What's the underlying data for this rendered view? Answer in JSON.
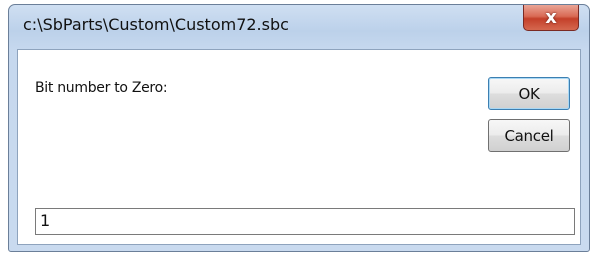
{
  "window": {
    "title": "c:\\SbParts\\Custom\\Custom72.sbc",
    "close_glyph": "x"
  },
  "dialog": {
    "prompt": "Bit number to Zero:",
    "ok_label": "OK",
    "cancel_label": "Cancel",
    "input_value": "1"
  },
  "icons": {
    "close": "close-icon"
  },
  "colors": {
    "titlebar": "#c6d8ee",
    "close_button": "#c4402a",
    "default_button_border": "#3c7fb1"
  }
}
